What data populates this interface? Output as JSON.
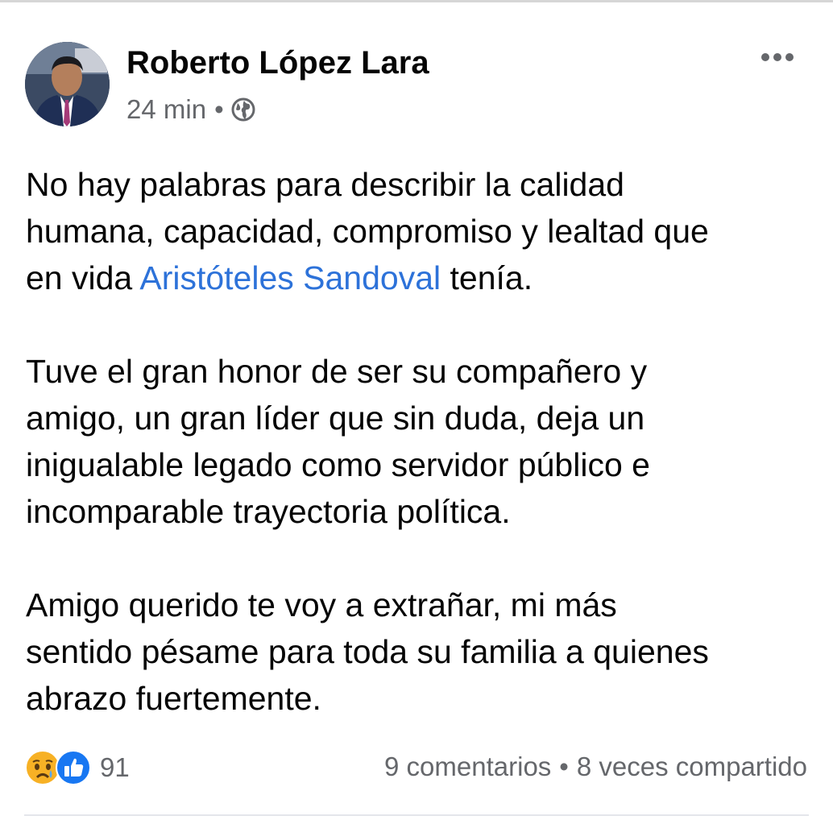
{
  "post": {
    "author": "Roberto López Lara",
    "timestamp": "24 min",
    "separator": "•",
    "privacy_icon": "globe-icon",
    "more_icon": "more-options-icon",
    "body": [
      {
        "before": "No hay palabras para describir la calidad",
        "line2": "humana, capacidad, compromiso y lealtad que",
        "line3_prefix": "en vida ",
        "mention": "Aristóteles Sandoval",
        "line3_suffix": " tenía."
      },
      {
        "line1": "Tuve el gran honor de ser su compañero y",
        "line2": "amigo, un gran líder que sin duda, deja un",
        "line3": "inigualable legado como servidor público e",
        "line4": "incomparable trayectoria política."
      },
      {
        "line1": "Amigo querido te voy a extrañar, mi más",
        "line2": "sentido pésame para toda su familia a quienes",
        "line3": "abrazo fuertemente."
      }
    ],
    "reactions": {
      "icons": [
        "sad-reaction-icon",
        "like-reaction-icon"
      ],
      "count": "91"
    },
    "comments": "9 comentarios",
    "stats_separator": "•",
    "shares": "8 veces compartido"
  },
  "colors": {
    "mention": "#2d72d9",
    "secondary_text": "#65676b",
    "like_blue": "#1877f2",
    "sad_yellow": "#f7b125"
  }
}
